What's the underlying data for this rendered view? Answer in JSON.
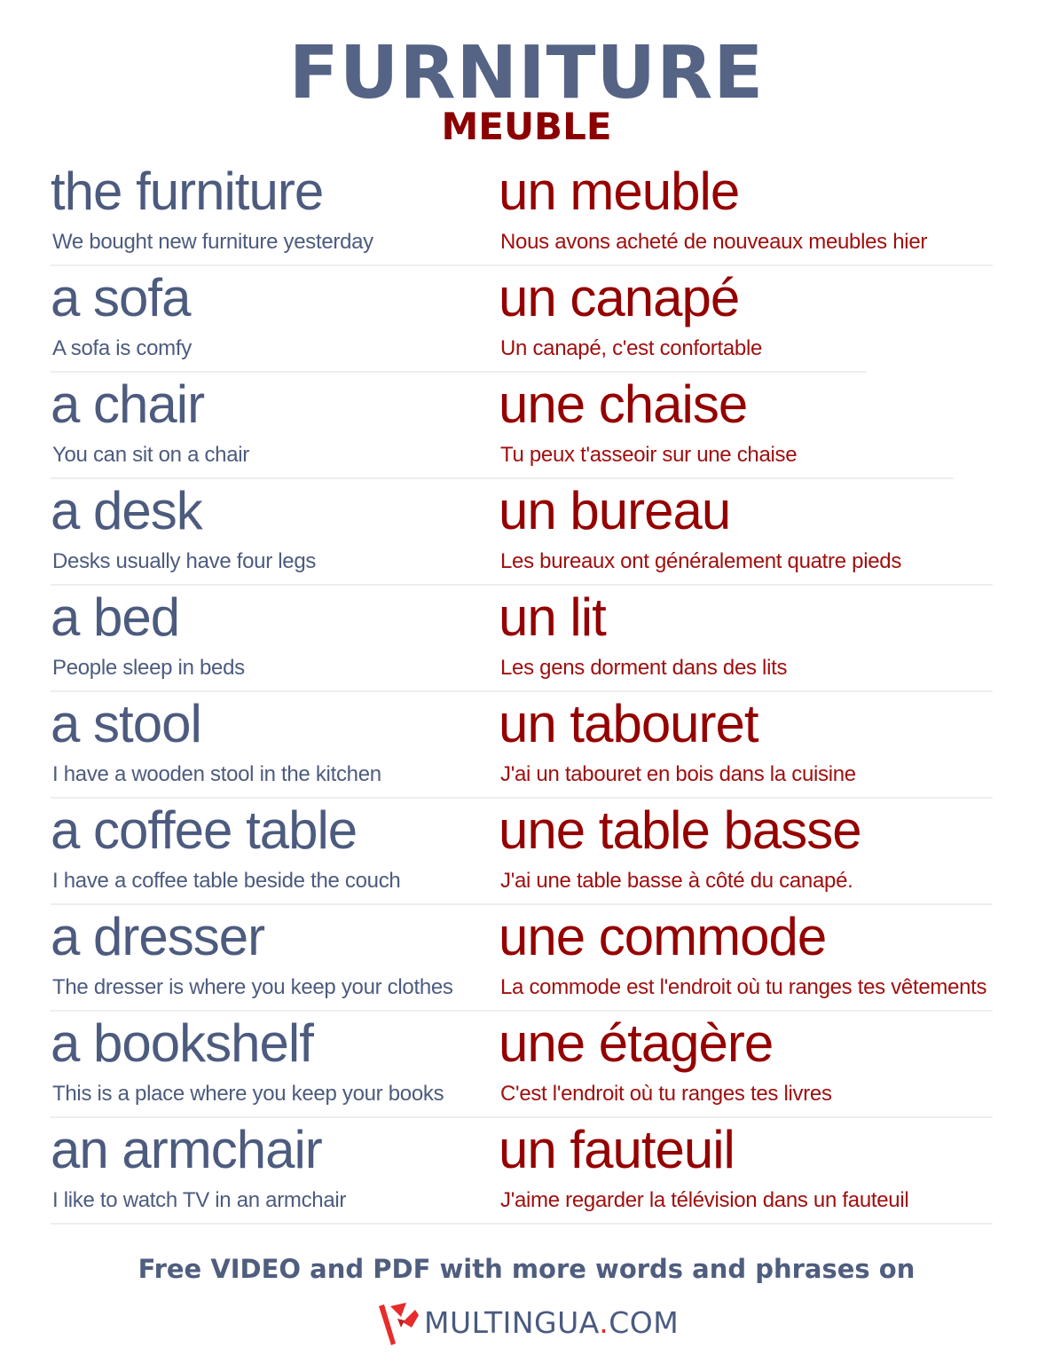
{
  "header": {
    "title": "FURNITURE",
    "subtitle": "MEUBLE"
  },
  "colors": {
    "english": "#4c5b7e",
    "french": "#950000",
    "logo_red": "#e82b2b"
  },
  "entries": [
    {
      "en": "the furniture",
      "en_example": "We bought new furniture yesterday",
      "fr": "un meuble",
      "fr_example": "Nous avons acheté de nouveaux meubles hier"
    },
    {
      "en": "a sofa",
      "en_example": "A sofa is comfy",
      "fr": "un canapé",
      "fr_example": "Un canapé, c'est confortable"
    },
    {
      "en": "a chair",
      "en_example": "You can sit on a chair",
      "fr": "une chaise",
      "fr_example": "Tu peux t'asseoir sur une chaise"
    },
    {
      "en": "a desk",
      "en_example": "Desks usually have four legs",
      "fr": "un bureau",
      "fr_example": "Les bureaux ont généralement quatre pieds"
    },
    {
      "en": "a bed",
      "en_example": "People sleep in beds",
      "fr": "un lit",
      "fr_example": "Les gens dorment dans des lits"
    },
    {
      "en": "a stool",
      "en_example": "I have a wooden stool in the kitchen",
      "fr": "un tabouret",
      "fr_example": "J'ai un tabouret en bois dans la cuisine"
    },
    {
      "en": "a coffee table",
      "en_example": "I have a coffee table beside the couch",
      "fr": "une table basse",
      "fr_example": "J'ai une table basse à côté du canapé."
    },
    {
      "en": "a dresser",
      "en_example": "The dresser is where you keep your clothes",
      "fr": "une commode",
      "fr_example": "La commode est l'endroit où tu ranges tes vêtements"
    },
    {
      "en": "a bookshelf",
      "en_example": "This is a place where you keep your books",
      "fr": "une étagère",
      "fr_example": "C'est l'endroit où tu ranges tes livres"
    },
    {
      "en": "an armchair",
      "en_example": "I like to watch TV in an armchair",
      "fr": "un fauteuil",
      "fr_example": "J'aime regarder la télévision dans un fauteuil"
    }
  ],
  "footer": {
    "promo": "Free VIDEO and PDF with more words and phrases on",
    "logo_icon": "multingua-logo-icon",
    "logo_name": "MULTINGUA",
    "logo_dot": ".",
    "logo_tld": "COM"
  }
}
